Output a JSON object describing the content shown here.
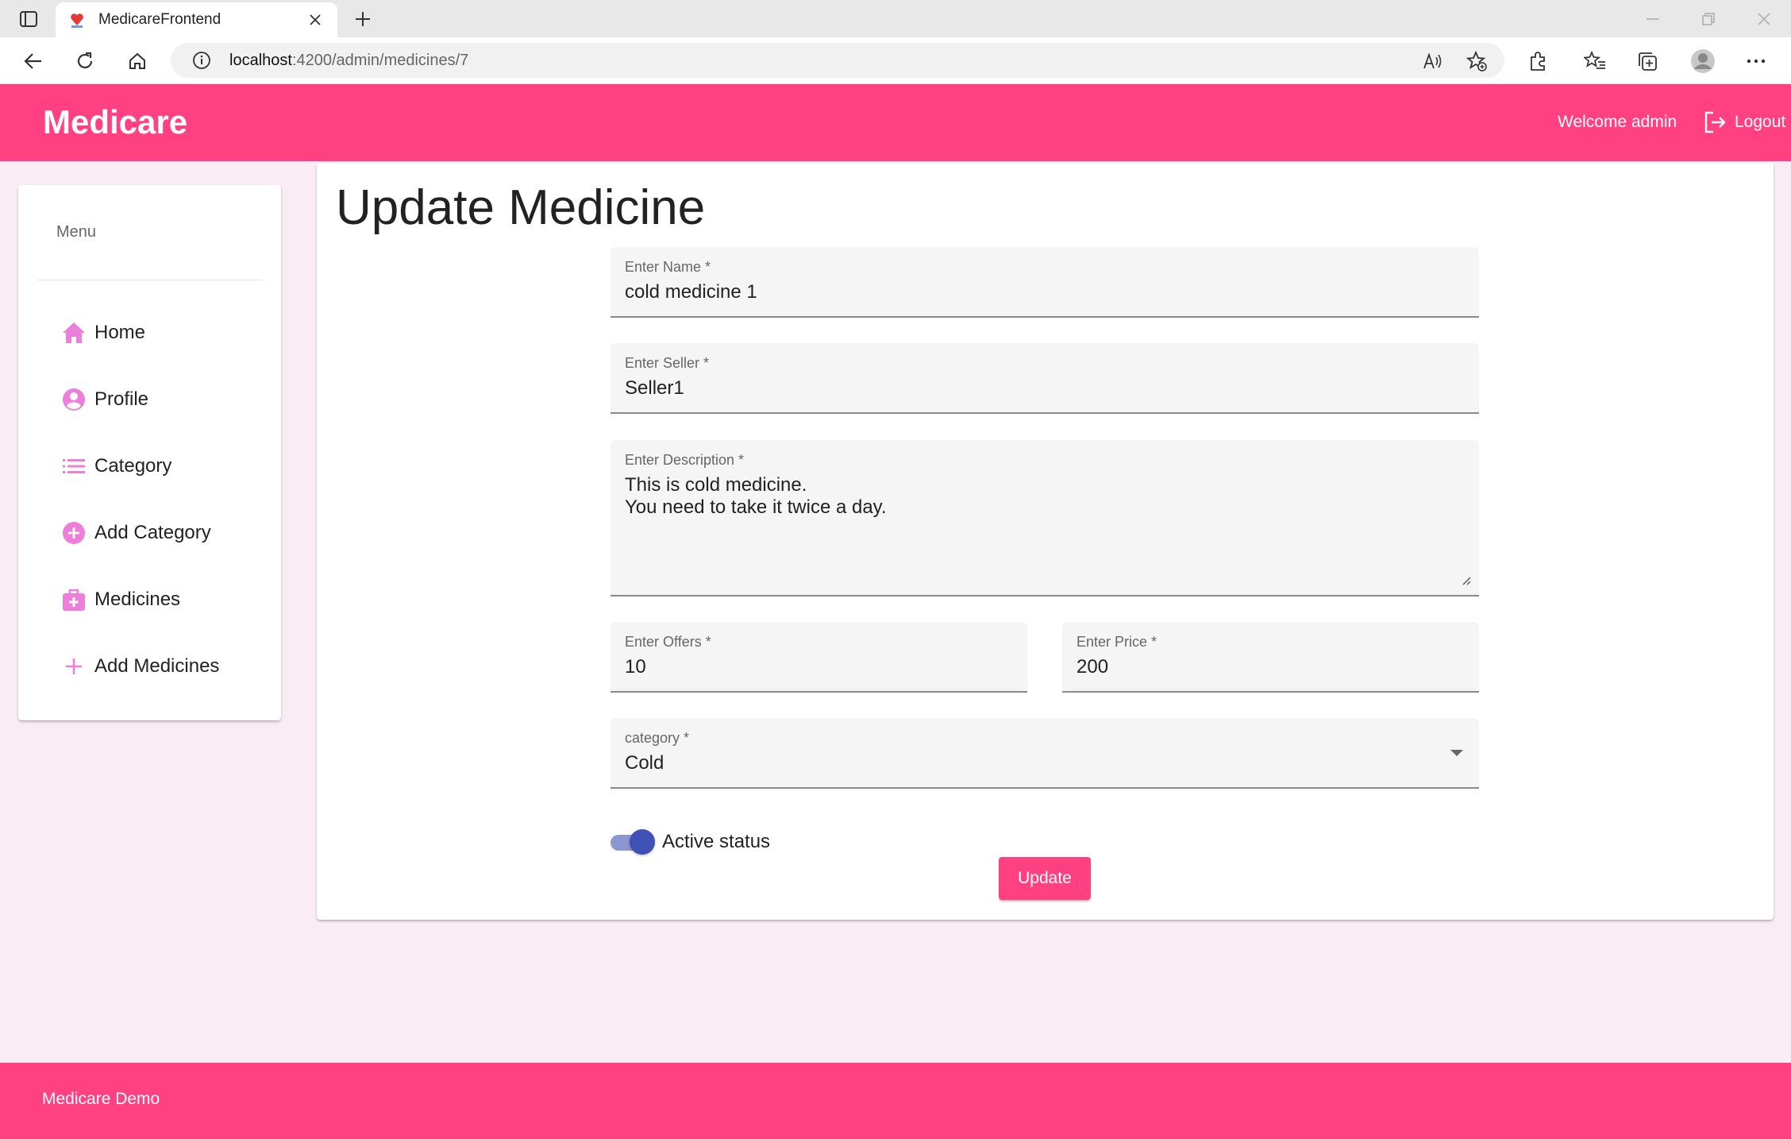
{
  "browser": {
    "tab_title": "MedicareFrontend",
    "url_host": "localhost",
    "url_path": ":4200/admin/medicines/7"
  },
  "header": {
    "brand": "Medicare",
    "welcome": "Welcome admin",
    "logout_label": "Logout",
    "color": "#ff4081"
  },
  "sidebar": {
    "title": "Menu",
    "icon_color": "#ec7fd9",
    "items": [
      {
        "label": "Home",
        "icon": "home-icon"
      },
      {
        "label": "Profile",
        "icon": "account-circle-icon"
      },
      {
        "label": "Category",
        "icon": "list-icon"
      },
      {
        "label": "Add Category",
        "icon": "add-circle-icon"
      },
      {
        "label": "Medicines",
        "icon": "medical-bag-icon"
      },
      {
        "label": "Add Medicines",
        "icon": "plus-icon"
      }
    ]
  },
  "form": {
    "title": "Update Medicine",
    "name": {
      "label": "Enter Name *",
      "value": "cold medicine 1"
    },
    "seller": {
      "label": "Enter Seller *",
      "value": "Seller1"
    },
    "description": {
      "label": "Enter Description *",
      "value": "This is cold medicine.\nYou need to take it twice a day."
    },
    "offers": {
      "label": "Enter Offers *",
      "value": "10"
    },
    "price": {
      "label": "Enter Price *",
      "value": "200"
    },
    "category": {
      "label": "category *",
      "value": "Cold"
    },
    "active": {
      "label": "Active status",
      "checked": true,
      "color": "#3f51b5"
    },
    "submit_label": "Update"
  },
  "footer": {
    "text": "Medicare Demo"
  }
}
